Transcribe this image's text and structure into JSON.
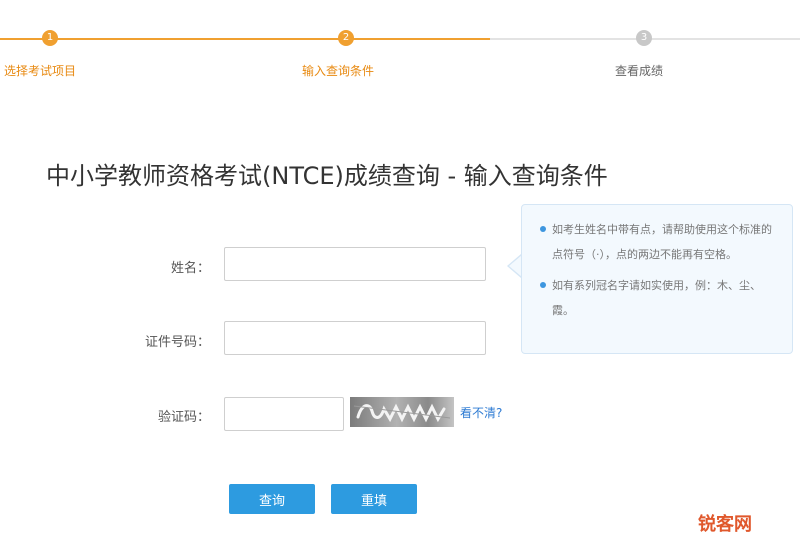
{
  "steps": [
    {
      "number": "1",
      "label": "选择考试项目",
      "state": "done"
    },
    {
      "number": "2",
      "label": "输入查询条件",
      "state": "done"
    },
    {
      "number": "3",
      "label": "查看成绩",
      "state": "todo"
    }
  ],
  "page_title": "中小学教师资格考试(NTCE)成绩查询 - 输入查询条件",
  "form": {
    "name_label": "姓名：",
    "name_value": "",
    "id_label": "证件号码：",
    "id_value": "",
    "captcha_label": "验证码：",
    "captcha_value": "",
    "captcha_refresh": "看不清?"
  },
  "tips": [
    "如考生姓名中带有点，请帮助使用这个标准的点符号（·），点的两边不能再有空格。",
    "如有系列冠名字请如实使用，例：木、尘、霞。"
  ],
  "buttons": {
    "query": "查询",
    "reset": "重填"
  },
  "watermark": "锐客网",
  "colors": {
    "accent_orange": "#f0a030",
    "primary_blue": "#2d9be0",
    "tip_background": "#f3f9fe",
    "link_blue": "#2e7bd3"
  }
}
